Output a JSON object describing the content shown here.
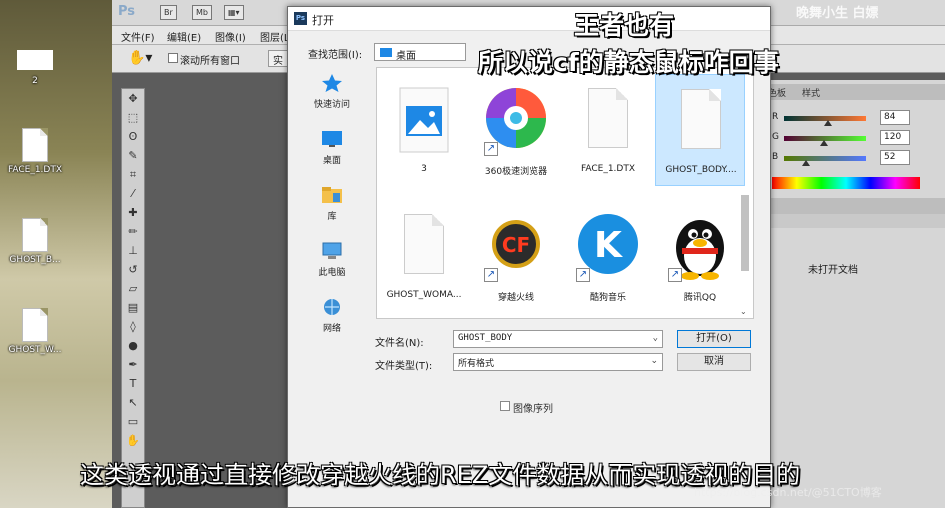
{
  "desktop": {
    "icons": [
      {
        "label": "2"
      },
      {
        "label": "FACE_1.DTX"
      },
      {
        "label": "GHOST_B..."
      },
      {
        "label": "GHOST_W..."
      }
    ]
  },
  "photoshop": {
    "logo": "Ps",
    "chips": [
      "Br",
      "Mb"
    ],
    "menu": [
      "文件(F)",
      "编辑(E)",
      "图像(I)",
      "图层(L)"
    ],
    "options": {
      "scroll_all_label": "滚动所有窗口",
      "button_label": "实"
    },
    "panel": {
      "tabs": [
        "色板",
        "样式"
      ],
      "r": "84",
      "g": "120",
      "b": "52",
      "r_letter": "R",
      "g_letter": "G",
      "b_letter": "B",
      "no_doc": "未打开文档"
    }
  },
  "dialog": {
    "title": "打开",
    "look_in_label": "查找范围(I):",
    "look_in_value": "桌面",
    "places": [
      {
        "label": "快速访问",
        "icon": "star-icon"
      },
      {
        "label": "桌面",
        "icon": "desktop-icon"
      },
      {
        "label": "库",
        "icon": "library-icon"
      },
      {
        "label": "此电脑",
        "icon": "computer-icon"
      },
      {
        "label": "网络",
        "icon": "network-icon"
      }
    ],
    "files": [
      {
        "label": "3",
        "kind": "image"
      },
      {
        "label": "360极速浏览器",
        "kind": "360-browser"
      },
      {
        "label": "FACE_1.DTX",
        "kind": "document"
      },
      {
        "label": "GHOST_BODY....",
        "kind": "document"
      },
      {
        "label": "GHOST_WOMA...",
        "kind": "document"
      },
      {
        "label": "穿越火线",
        "kind": "crossfire"
      },
      {
        "label": "酷狗音乐",
        "kind": "kugou"
      },
      {
        "label": "腾讯QQ",
        "kind": "qq"
      }
    ],
    "filename_label": "文件名(N):",
    "filename_value": "GHOST_BODY",
    "filetype_label": "文件类型(T):",
    "filetype_value": "所有格式",
    "open_button": "打开(O)",
    "cancel_button": "取消",
    "image_sequence_label": "图像序列"
  },
  "captions": {
    "top_line1": "王者也有",
    "top_line2": "所以说cf的静态鼠标咋回事",
    "corner": "晚舞小生  白嫖",
    "bottom": "这类透视通过直接修改穿越火线的REZ文件数据从而实现透视的目的",
    "watermark": "https://blog.csdn.net/@51CTO博客"
  },
  "colors": {
    "accent": "#0078d7",
    "selection": "#cce8ff",
    "ps_bg": "#5c5c5c"
  }
}
